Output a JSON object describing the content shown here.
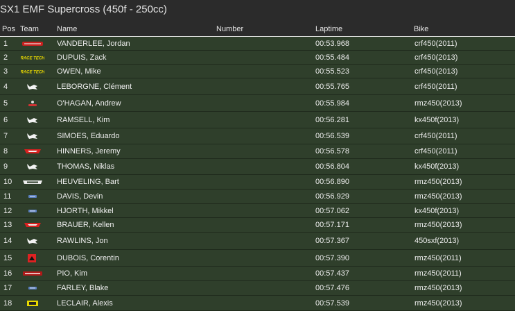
{
  "title": "SX1 EMF Supercross (450f - 250cc)",
  "headers": {
    "pos": "Pos",
    "team": "Team",
    "name": "Name",
    "number": "Number",
    "laptime": "Laptime",
    "bike": "Bike"
  },
  "rows": [
    {
      "pos": "1",
      "team": "team-logo-red-script-icon",
      "name": "VANDERLEE, Jordan",
      "laptime": "00:53.968",
      "bike": "crf450(2011)"
    },
    {
      "pos": "2",
      "team": "race-tech-logo",
      "team_text": "RACE TECH",
      "name": "DUPUIS, Zack",
      "laptime": "00:55.484",
      "bike": "crf450(2013)"
    },
    {
      "pos": "3",
      "team": "race-tech-logo",
      "team_text": "RACE TECH",
      "name": "OWEN, Mike",
      "laptime": "00:55.523",
      "bike": "crf450(2013)"
    },
    {
      "pos": "4",
      "team": "white-bird-logo-icon",
      "name": "LEBORGNE, Clément",
      "laptime": "00:55.765",
      "bike": "crf450(2011)"
    },
    {
      "pos": "5",
      "team": "small-rider-logo-icon",
      "name": "O'HAGAN, Andrew",
      "laptime": "00:55.984",
      "bike": "rmz450(2013)"
    },
    {
      "pos": "6",
      "team": "white-bird-logo-icon",
      "name": "RAMSELL, Kim",
      "laptime": "00:56.281",
      "bike": "kx450f(2013)"
    },
    {
      "pos": "7",
      "team": "white-bird-logo-icon",
      "name": "SIMOES, Eduardo",
      "laptime": "00:56.539",
      "bike": "crf450(2011)"
    },
    {
      "pos": "8",
      "team": "fly-logo-icon",
      "name": "HINNERS, Jeremy",
      "laptime": "00:56.578",
      "bike": "crf450(2011)"
    },
    {
      "pos": "9",
      "team": "white-bird-logo-icon",
      "name": "THOMAS, Niklas",
      "laptime": "00:56.804",
      "bike": "kx450f(2013)"
    },
    {
      "pos": "10",
      "team": "gmc-logo-icon",
      "name": "HEUVELING, Bart",
      "laptime": "00:56.890",
      "bike": "rmz450(2013)"
    },
    {
      "pos": "11",
      "team": "blue-small-logo-icon",
      "name": "DAVIS, Devin",
      "laptime": "00:56.929",
      "bike": "rmz450(2013)"
    },
    {
      "pos": "12",
      "team": "blue-small-logo-icon",
      "name": "HJORTH, Mikkel",
      "laptime": "00:57.062",
      "bike": "kx450f(2013)"
    },
    {
      "pos": "13",
      "team": "fly-logo-icon",
      "name": "BRAUER, Kellen",
      "laptime": "00:57.171",
      "bike": "rmz450(2013)"
    },
    {
      "pos": "14",
      "team": "white-bird-logo-icon",
      "name": "RAWLINS, Jon",
      "laptime": "00:57.367",
      "bike": "450sxf(2013)"
    },
    {
      "pos": "15",
      "team": "red-square-logo-icon",
      "name": "DUBOIS, Corentin",
      "laptime": "00:57.390",
      "bike": "rmz450(2011)"
    },
    {
      "pos": "16",
      "team": "ice-logo-icon",
      "name": "PIO, Kim",
      "laptime": "00:57.437",
      "bike": "rmz450(2011)"
    },
    {
      "pos": "17",
      "team": "blue-small-logo-icon",
      "name": "FARLEY, Blake",
      "laptime": "00:57.476",
      "bike": "rmz450(2013)"
    },
    {
      "pos": "18",
      "team": "yellow-logo-icon",
      "name": "LECLAIR, Alexis",
      "laptime": "00:57.539",
      "bike": "rmz450(2013)"
    }
  ],
  "colors": {
    "background": "#2b2b2b",
    "row_background": "#2f3f2b",
    "row_border": "#1f2a1c",
    "header_rule": "#e6e6e6",
    "race_tech_yellow": "#e8d800",
    "red_logo": "#d8201f"
  }
}
